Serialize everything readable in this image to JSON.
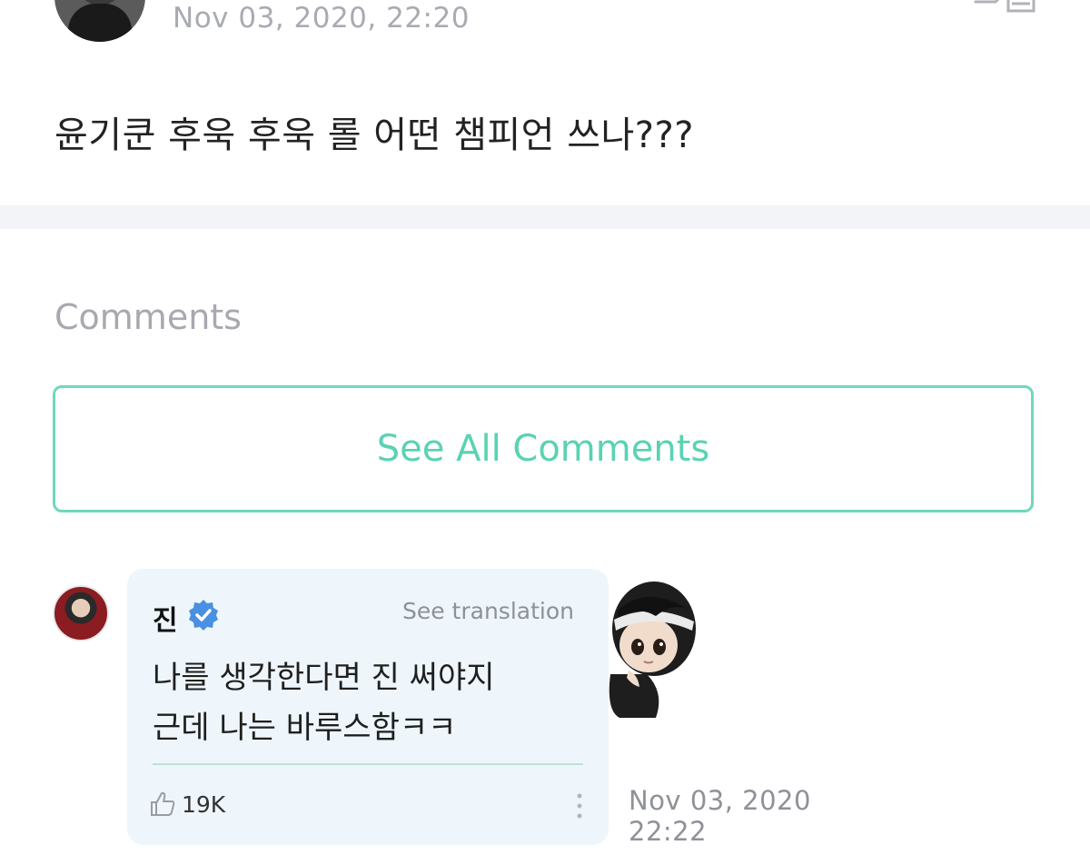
{
  "post": {
    "date": "Nov 03, 2020, 22:20",
    "text": "윤기쿤 후욱 후욱 롤 어떤 챔피언 쓰나???"
  },
  "comments_section": {
    "heading": "Comments",
    "see_all_label": "See All Comments"
  },
  "comment": {
    "author": "진",
    "translate_label": "See translation",
    "lines": [
      "나를 생각한다면 진 써야지",
      "근데 나는 바루스함ㅋㅋ"
    ],
    "likes": "19K",
    "date_line1": "Nov 03, 2020",
    "date_line2": "22:22"
  },
  "colors": {
    "accent": "#5ad2b3",
    "bubble_bg": "#eef6fb",
    "verified": "#4a90e2"
  },
  "icons": [
    "share-icon",
    "verified-icon",
    "thumbs-up-icon",
    "more-icon"
  ]
}
